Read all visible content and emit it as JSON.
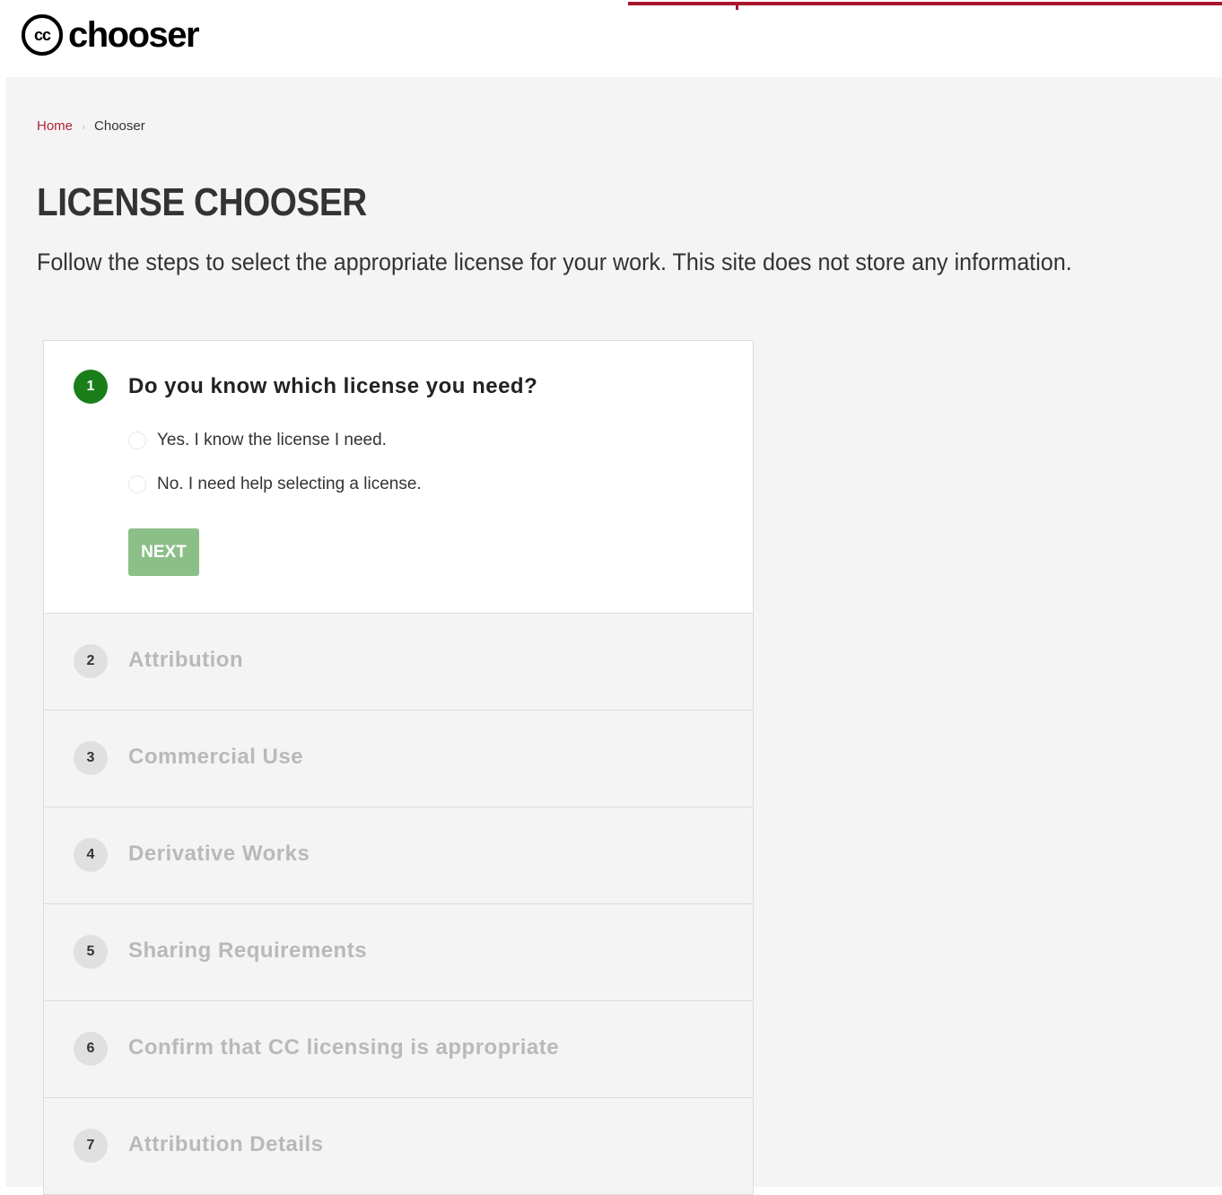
{
  "brand": {
    "logo_mark": "cc",
    "logo_text": "chooser"
  },
  "colors": {
    "accent_red": "#a8152b",
    "breadcrumb_link": "#b0253a",
    "active_step_green": "#1a7f1a",
    "next_button_disabled": "#8cbf88",
    "page_background": "#f4f4f4"
  },
  "breadcrumb": {
    "home": "Home",
    "separator": "›",
    "current": "Chooser"
  },
  "page": {
    "title": "LICENSE CHOOSER",
    "intro": "Follow the steps to select the appropriate license for your work. This site does not store any information."
  },
  "steps": [
    {
      "number": "1",
      "title": "Do you know which license you need?",
      "options": [
        "Yes. I know the license I need.",
        "No. I need help selecting a license."
      ],
      "next_label": "NEXT"
    },
    {
      "number": "2",
      "title": "Attribution"
    },
    {
      "number": "3",
      "title": "Commercial Use"
    },
    {
      "number": "4",
      "title": "Derivative Works"
    },
    {
      "number": "5",
      "title": "Sharing Requirements"
    },
    {
      "number": "6",
      "title": "Confirm that CC licensing is appropriate"
    },
    {
      "number": "7",
      "title": "Attribution Details"
    }
  ]
}
